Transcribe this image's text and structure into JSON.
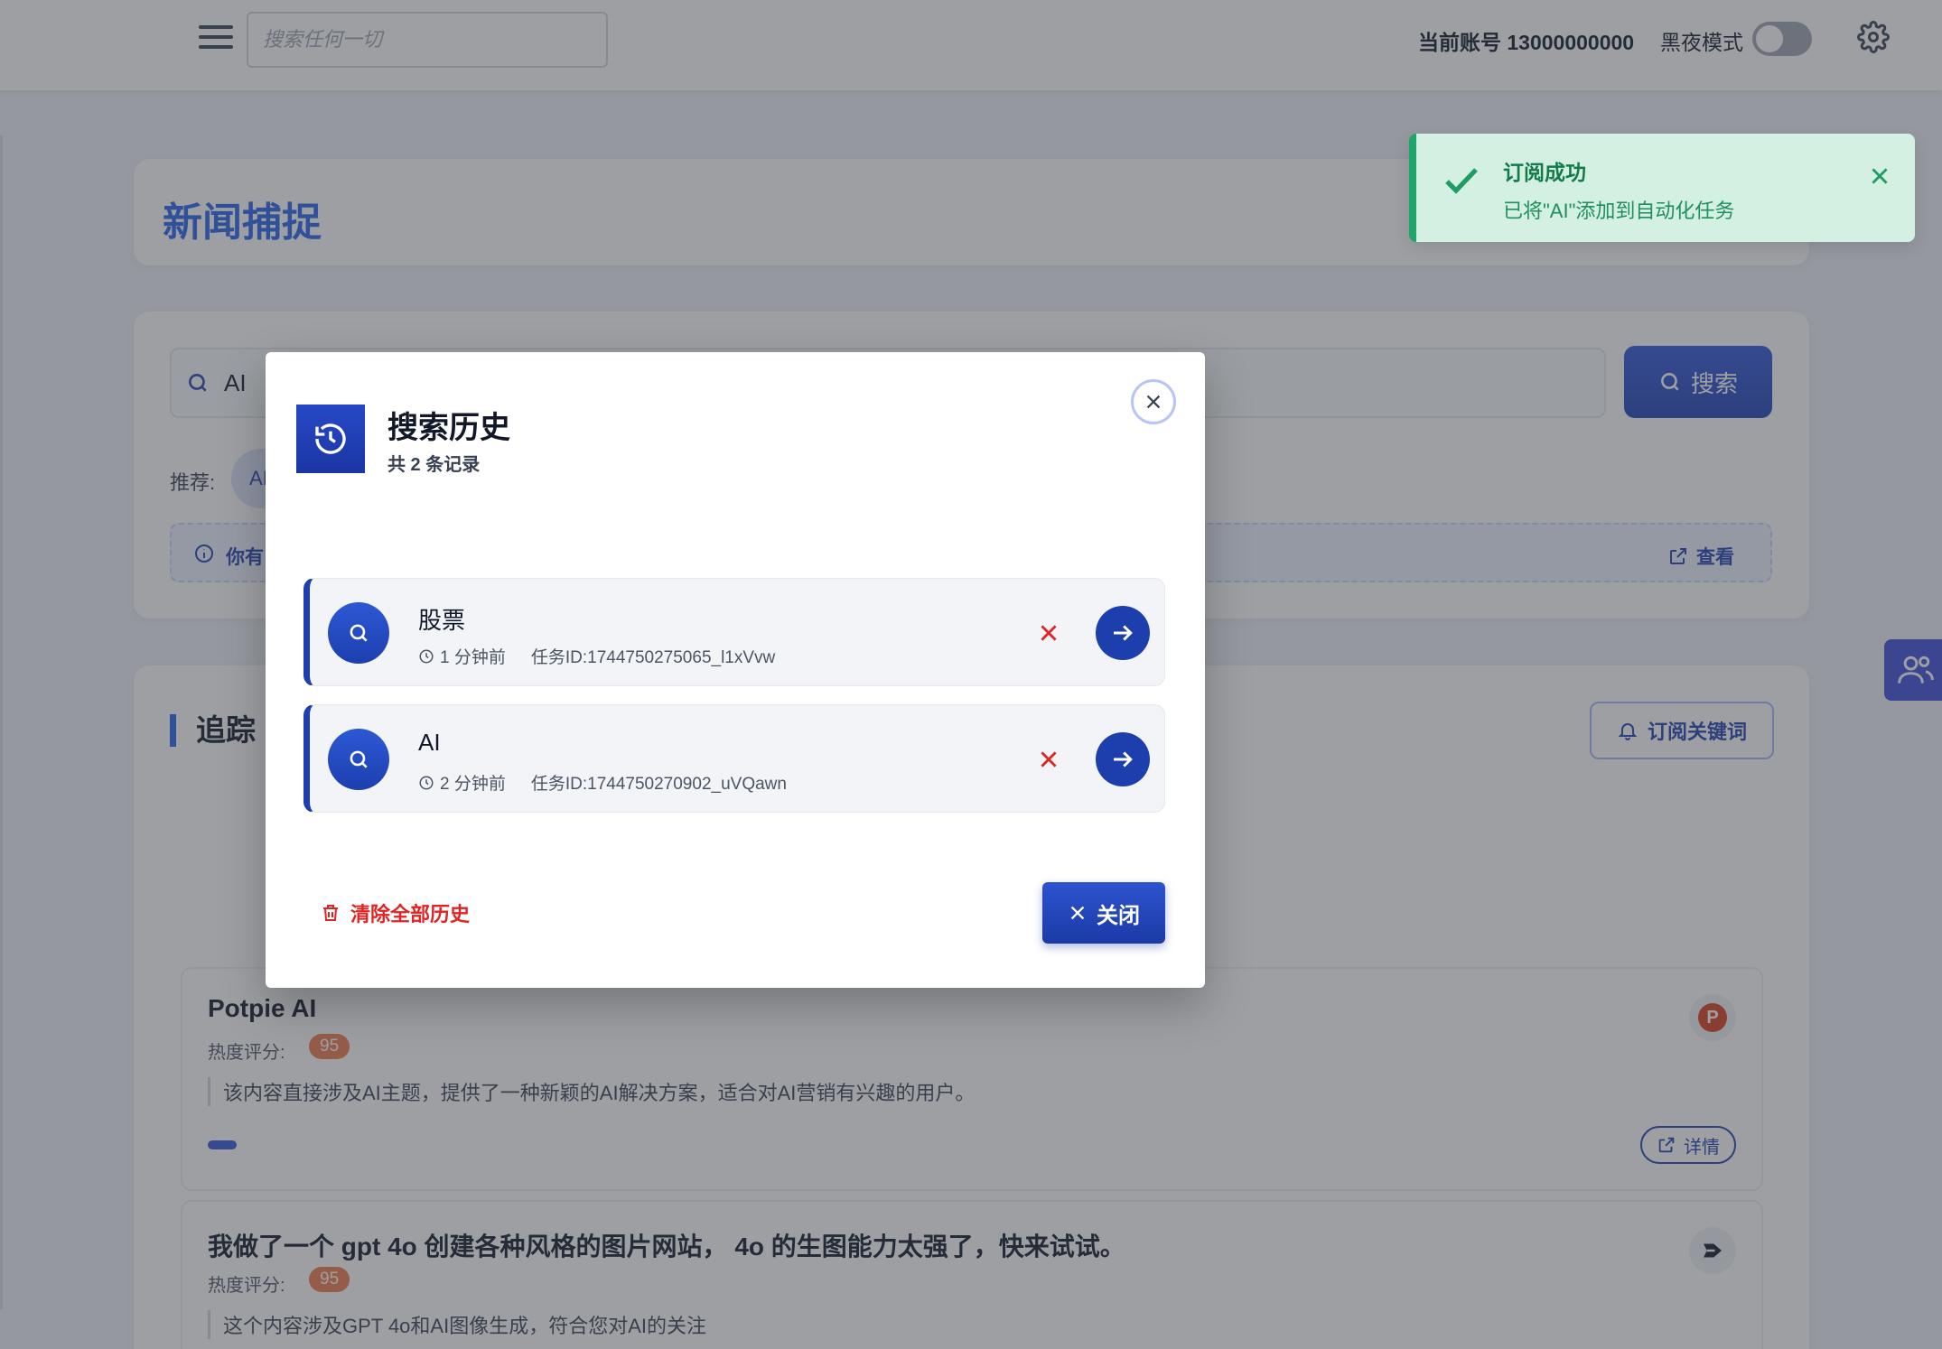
{
  "topbar": {
    "search_placeholder": "搜索任何一切",
    "account_label": "当前账号 13000000000",
    "dark_mode_label": "黑夜模式",
    "dark_mode_on": false
  },
  "page": {
    "title": "新闻捕捉"
  },
  "search": {
    "value": "AI",
    "button_label": "搜索",
    "recommend_label": "推荐:",
    "recommend_chip": "AI",
    "notice_text": "你有",
    "notice_view_label": "查看"
  },
  "tracking": {
    "title": "追踪",
    "subscribe_label": "订阅关键词",
    "items": [
      {
        "title": "Potpie AI",
        "heat_label": "热度评分:",
        "heat_score": "95",
        "desc": "该内容直接涉及AI主题，提供了一种新颖的AI解决方案，适合对AI营销有兴趣的用户。",
        "detail_label": "详情",
        "source_logo": "P"
      },
      {
        "title": "我做了一个 gpt 4o 创建各种风格的图片网站， 4o 的生图能力太强了，快来试试。",
        "heat_label": "热度评分:",
        "heat_score": "95",
        "desc": "这个内容涉及GPT 4o和AI图像生成，符合您对AI的关注"
      }
    ]
  },
  "toast": {
    "title": "订阅成功",
    "message": "已将\"AI\"添加到自动化任务"
  },
  "modal": {
    "title": "搜索历史",
    "subtitle": "共 2 条记录",
    "items": [
      {
        "keyword": "股票",
        "time": "1 分钟前",
        "task_id": "任务ID:1744750275065_l1xVvw"
      },
      {
        "keyword": "AI",
        "time": "2 分钟前",
        "task_id": "任务ID:1744750270902_uVQawn"
      }
    ],
    "clear_all_label": "清除全部历史",
    "close_label": "关闭"
  },
  "colors": {
    "accent": "#1e3fae",
    "success": "#1ea56a",
    "danger": "#e02424",
    "heat": "#ef7a4a"
  }
}
